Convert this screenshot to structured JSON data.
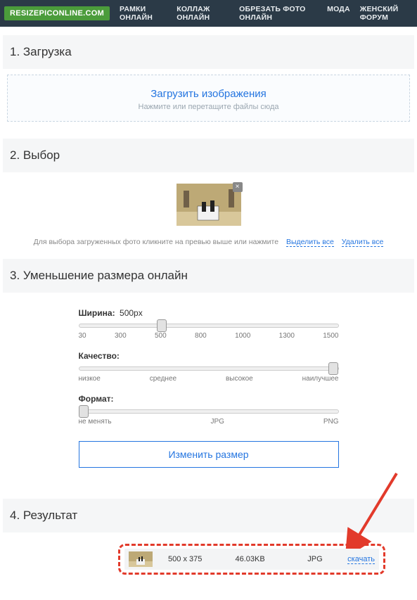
{
  "brand": "RESIZEPICONLINE.COM",
  "nav": [
    "РАМКИ ОНЛАЙН",
    "КОЛЛАЖ ОНЛАЙН",
    "ОБРЕЗАТЬ ФОТО ОНЛАЙН",
    "МОДА",
    "ЖЕНСКИЙ ФОРУМ"
  ],
  "sections": {
    "s1": "1. Загрузка",
    "s2": "2. Выбор",
    "s3": "3. Уменьшение размера онлайн",
    "s4": "4. Результат"
  },
  "upload": {
    "link": "Загрузить изображения",
    "sub": "Нажмите или перетащите файлы сюда"
  },
  "select": {
    "caption": "Для выбора загруженных фото кликните на превью выше или нажмите",
    "select_all": "Выделить все",
    "delete_all": "Удалить все",
    "close": "×"
  },
  "controls": {
    "width_label": "Ширина:",
    "width_value": "500px",
    "width_ticks": [
      "30",
      "300",
      "500",
      "800",
      "1000",
      "1300",
      "1500"
    ],
    "quality_label": "Качество:",
    "quality_ticks": [
      "низкое",
      "среднее",
      "высокое",
      "наилучшее"
    ],
    "format_label": "Формат:",
    "format_ticks": [
      "не менять",
      "JPG",
      "PNG"
    ],
    "resize_btn": "Изменить размер"
  },
  "result": {
    "dims": "500 x 375",
    "size": "46.03KB",
    "fmt": "JPG",
    "download": "скачать"
  }
}
